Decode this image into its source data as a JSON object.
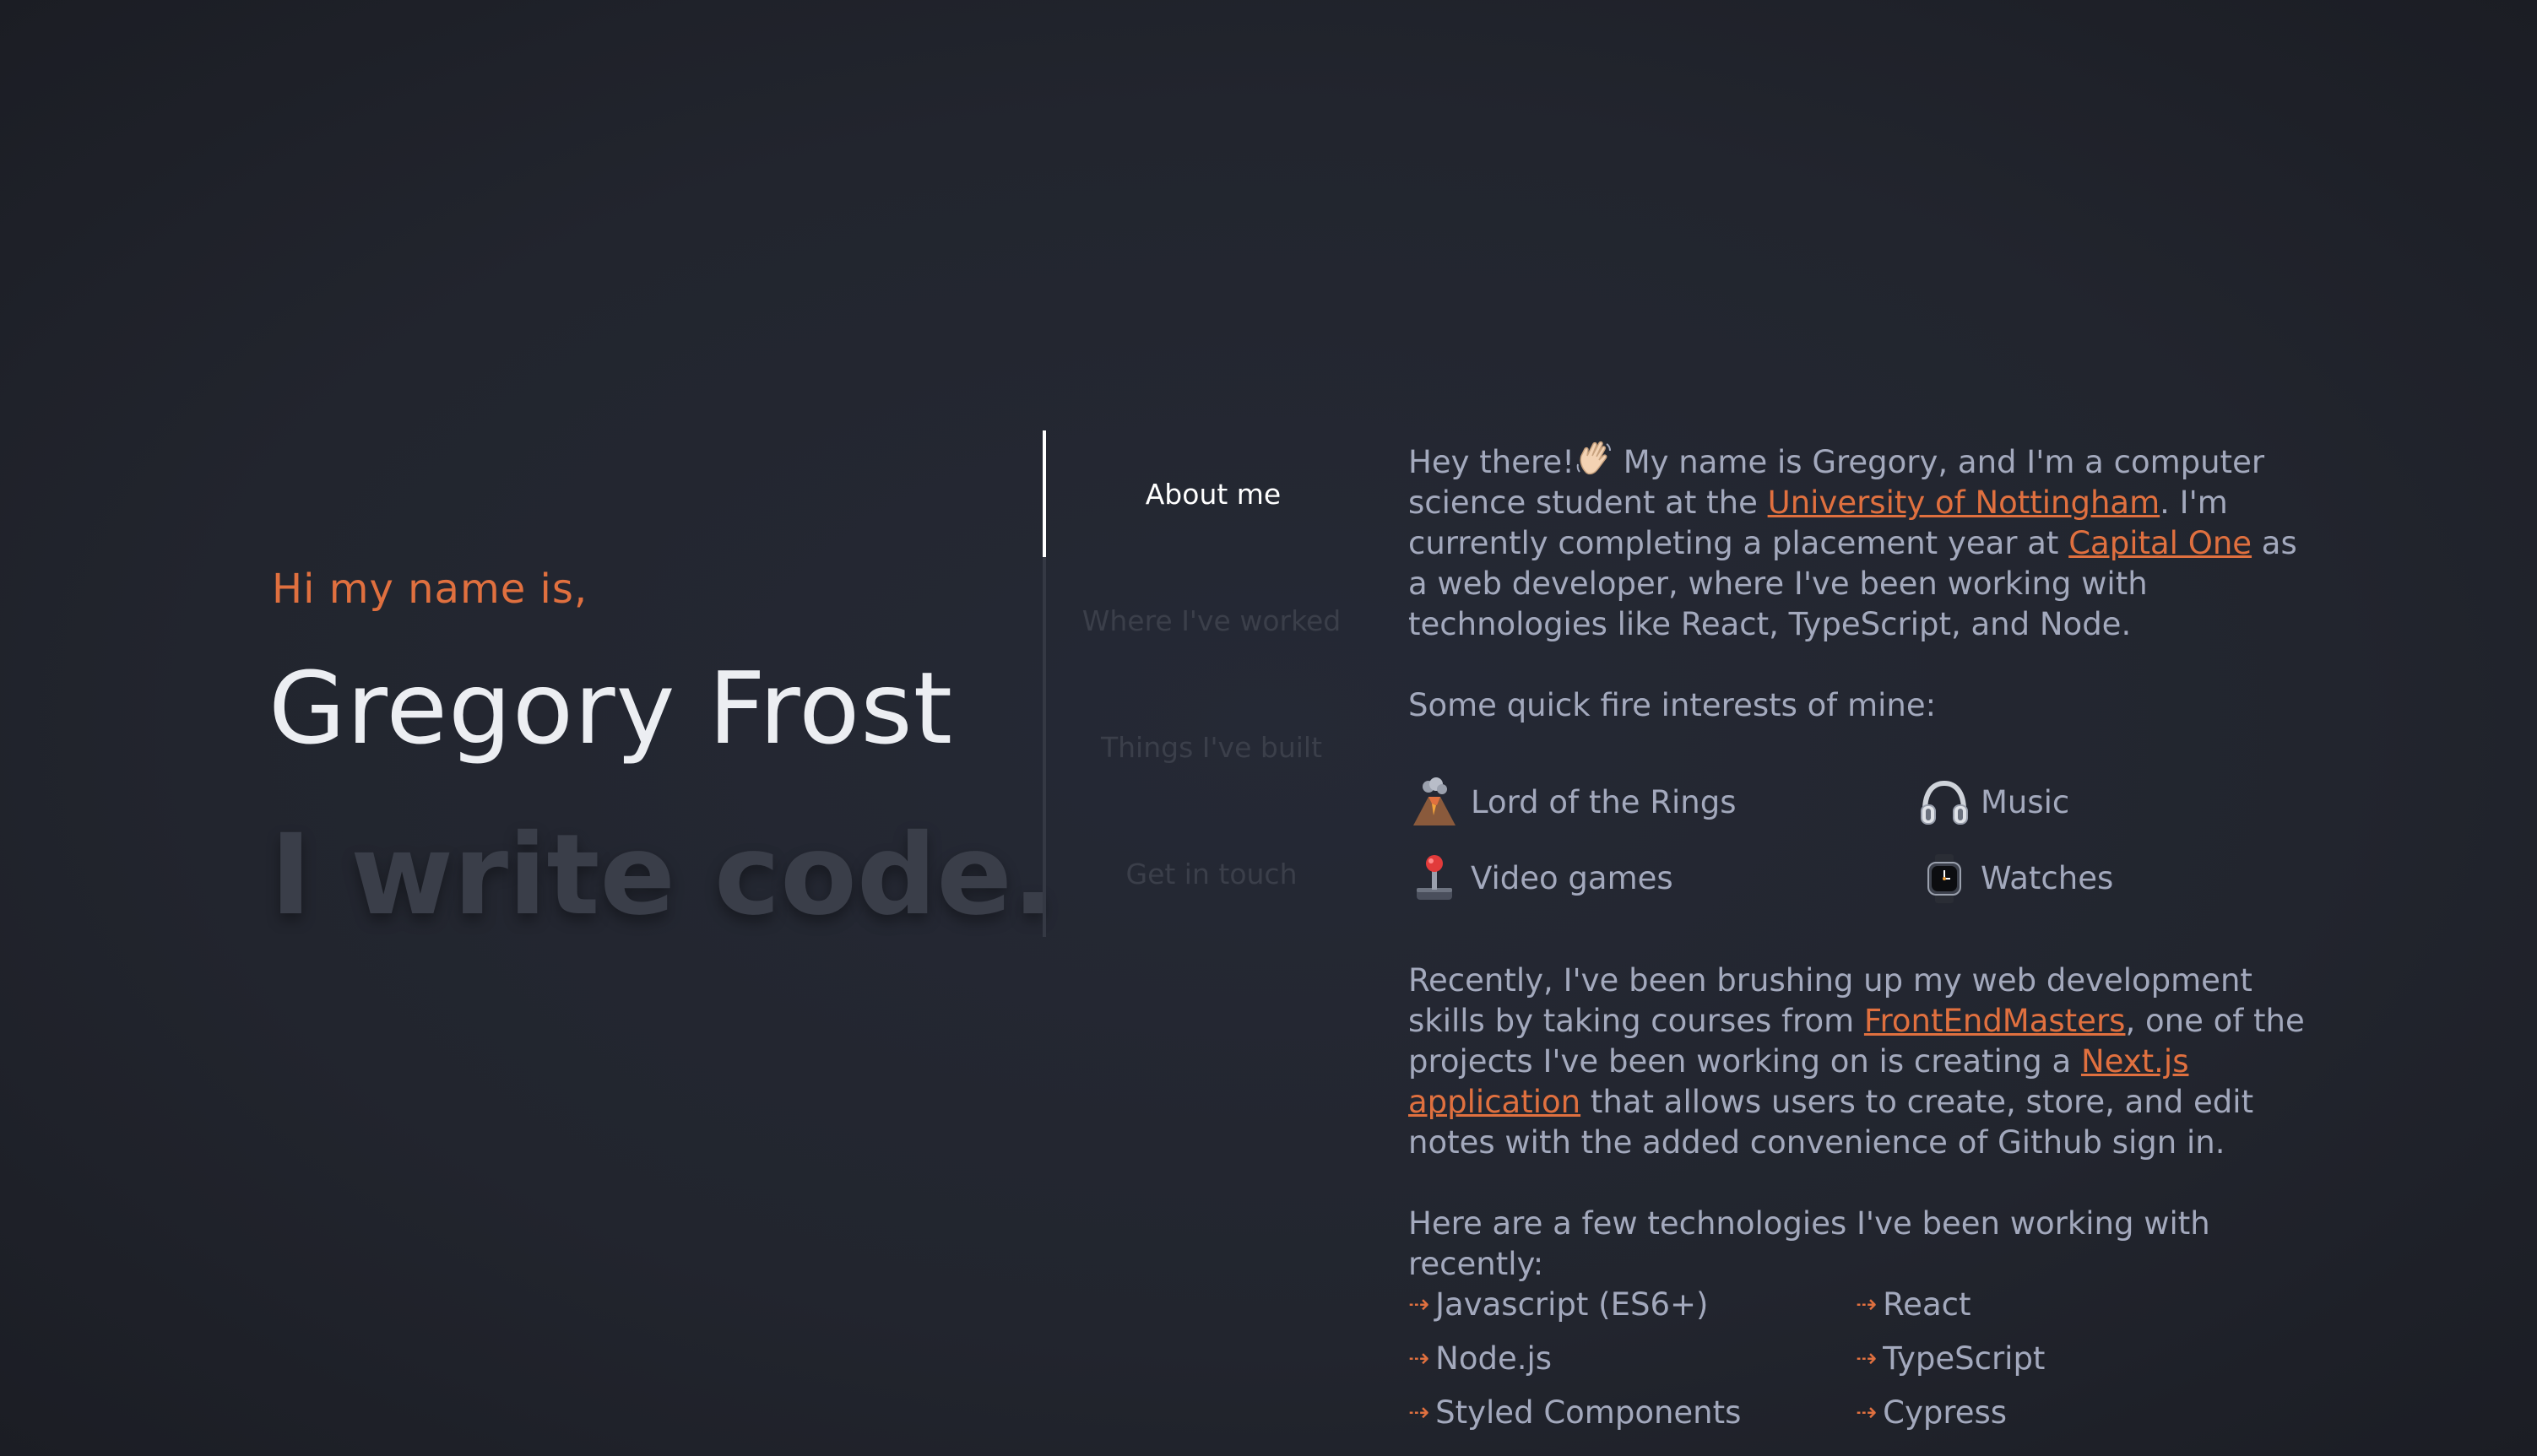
{
  "hero": {
    "greeting": "Hi my name is,",
    "name": "Gregory Frost",
    "tagline": "I write code."
  },
  "tabs": [
    {
      "label": "About me",
      "active": true
    },
    {
      "label": "Where I've worked",
      "active": false
    },
    {
      "label": "Things I've built",
      "active": false
    },
    {
      "label": "Get in touch",
      "active": false
    }
  ],
  "about": {
    "intro_1": "Hey there!",
    "intro_2": " My name is Gregory, and I'm a computer science student at the ",
    "university_link": "University of Nottingham",
    "intro_3": ". I'm currently completing a placement year at ",
    "employer_link": "Capital One",
    "intro_4": " as a web developer, where I've been working with technologies like React, TypeScript, and Node.",
    "interests_heading": "Some quick fire interests of mine:",
    "interests": [
      {
        "label": "Lord of the Rings",
        "icon": "volcano-icon"
      },
      {
        "label": "Music",
        "icon": "headphones-icon"
      },
      {
        "label": "Video games",
        "icon": "joystick-icon"
      },
      {
        "label": "Watches",
        "icon": "watch-icon"
      }
    ],
    "recent_1": "Recently, I've been brushing up my web development skills by taking courses from ",
    "courses_link": "FrontEndMasters",
    "recent_2": ", one of the projects I've been working on is creating a ",
    "project_link": "Next.js application",
    "recent_3": " that allows users to create, store, and edit notes with the added convenience of Github sign in.",
    "tech_heading": "Here are a few technologies I've been working with recently:",
    "technologies": [
      "Javascript (ES6+)",
      "React",
      "Node.js",
      "TypeScript",
      "Styled Components",
      "Cypress"
    ]
  },
  "colors": {
    "background": "#21242d",
    "accent": "#e0703f",
    "text": "#a3a9bd",
    "heading": "#eceef2",
    "muted": "#3a3e49"
  }
}
